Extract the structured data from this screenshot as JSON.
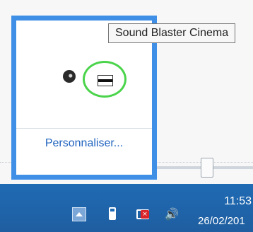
{
  "tooltip": {
    "text": "Sound Blaster Cinema"
  },
  "overflow_panel": {
    "icons": [
      {
        "name": "black-ball-icon"
      },
      {
        "name": "sound-blaster-icon"
      }
    ],
    "customize_label": "Personnaliser..."
  },
  "taskbar": {
    "tray_icons": [
      "show-hidden-icons-arrow-icon",
      "battery-icon",
      "network-error-icon",
      "volume-icon"
    ],
    "time": "11:53",
    "date": "26/02/201"
  },
  "colors": {
    "taskbar": "#1f6bb4",
    "panel_border": "#3f8fe6",
    "link": "#1f63bf",
    "highlight_circle": "#4bd44b",
    "network_error": "#d9252a"
  }
}
